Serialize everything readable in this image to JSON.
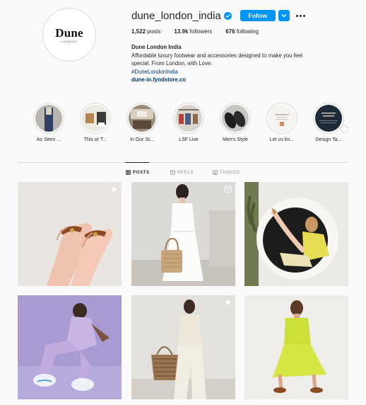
{
  "profile": {
    "avatar_logo": "Dune",
    "avatar_logo_sub": "LONDON",
    "username": "dune_london_india",
    "follow_label": "Follow",
    "stats": {
      "posts_count": "1,522",
      "posts_label": "posts",
      "followers_count": "13.9k",
      "followers_label": "followers",
      "following_count": "676",
      "following_label": "following"
    },
    "bio": {
      "name": "Dune London India",
      "line1": "Affordable luxury footwear and accessories designed to make you feel",
      "line2": "special. From London, with Love.",
      "hashtag": "#DuneLondonIndia",
      "link": "dune-in.fyndstore.co"
    }
  },
  "highlights": [
    {
      "label": "As Seen ..."
    },
    {
      "label": "This or T..."
    },
    {
      "label": "In Our St..."
    },
    {
      "label": "LSF Live"
    },
    {
      "label": "Men's Style"
    },
    {
      "label": "Let us kn..."
    },
    {
      "label": "Design Ta..."
    }
  ],
  "tabs": [
    {
      "label": "POSTS",
      "icon": "grid-icon"
    },
    {
      "label": "REELS",
      "icon": "reels-icon"
    },
    {
      "label": "TAGGED",
      "icon": "tagged-icon"
    }
  ],
  "colors": {
    "accent": "#0095f6",
    "link": "#00376b",
    "background": "#fafafa"
  }
}
